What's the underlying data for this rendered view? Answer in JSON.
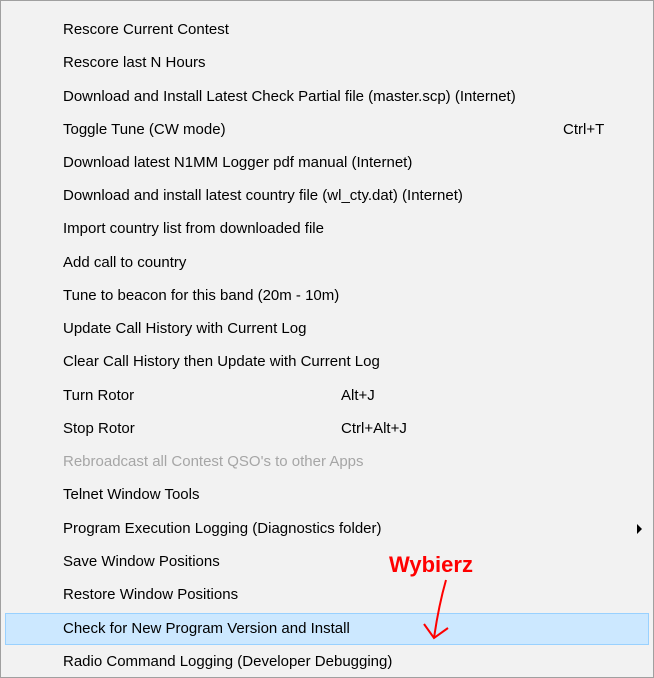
{
  "menu": {
    "items": [
      {
        "label": "Rescore Current Contest"
      },
      {
        "label": "Rescore last N Hours"
      },
      {
        "label": "Download and Install Latest Check Partial file (master.scp) (Internet)"
      },
      {
        "label": "Toggle Tune (CW mode)",
        "shortcut": "Ctrl+T"
      },
      {
        "label": "Download latest N1MM Logger pdf manual (Internet)"
      },
      {
        "label": "Download and install latest country file (wl_cty.dat) (Internet)"
      },
      {
        "label": "Import country list from downloaded file"
      },
      {
        "label": "Add call to country"
      },
      {
        "label": "Tune to beacon for this band  (20m - 10m)"
      },
      {
        "label": "Update Call History with Current Log"
      },
      {
        "label": "Clear Call History then Update with Current Log"
      },
      {
        "label": "Turn Rotor",
        "shortcut": "Alt+J"
      },
      {
        "label": "Stop Rotor",
        "shortcut": "Ctrl+Alt+J"
      },
      {
        "label": "Rebroadcast all Contest QSO's to other Apps",
        "disabled": true
      },
      {
        "label": "Telnet Window Tools"
      },
      {
        "label": "Program Execution Logging (Diagnostics folder)",
        "submenu": true
      },
      {
        "label": "Save Window Positions"
      },
      {
        "label": "Restore Window Positions"
      },
      {
        "label": "Check for New Program Version and Install",
        "highlighted": true
      },
      {
        "label": "Radio Command Logging  (Developer Debugging)"
      }
    ]
  },
  "annotation": {
    "text": "Wybierz",
    "color": "#ff0000"
  },
  "colors": {
    "highlight_bg": "#cce8ff",
    "highlight_border": "#99d1ff",
    "disabled_text": "#a6a6a6"
  }
}
